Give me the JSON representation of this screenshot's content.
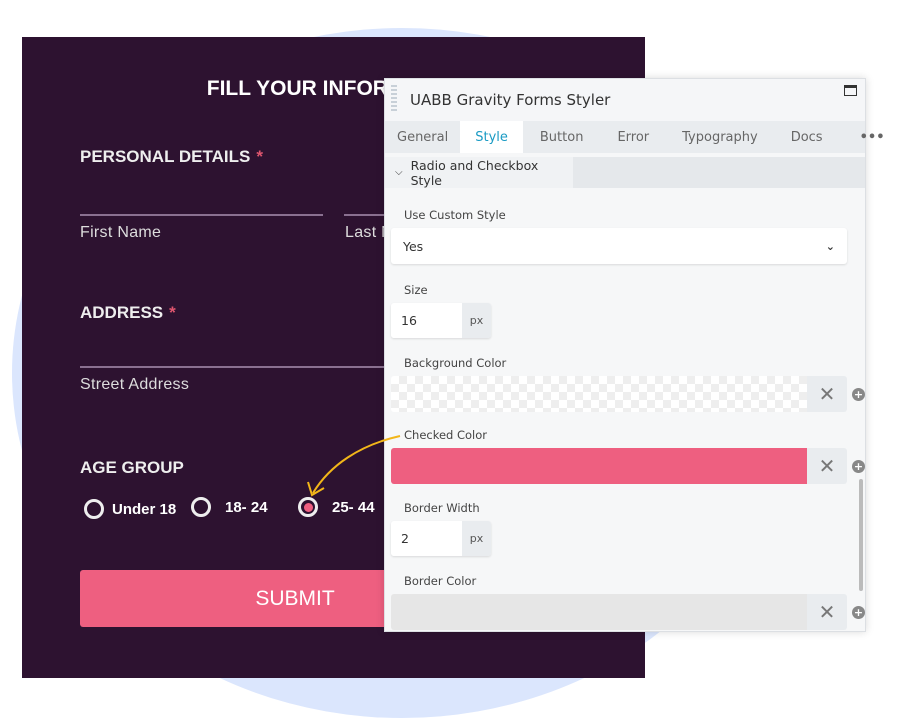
{
  "form": {
    "title": "FILL YOUR INFORMATION",
    "personal_details": "PERSONAL DETAILS",
    "required_mark": "*",
    "first_name": "First Name",
    "last_name": "Last Name",
    "address": "ADDRESS",
    "street_address": "Street Address",
    "age_group": "AGE GROUP",
    "age_options": [
      {
        "label": "Under 18",
        "checked": false
      },
      {
        "label": "18- 24",
        "checked": false
      },
      {
        "label": "25- 44",
        "checked": true
      }
    ],
    "submit": "SUBMIT"
  },
  "panel": {
    "title": "UABB Gravity Forms Styler",
    "tabs": [
      "General",
      "Style",
      "Button",
      "Error",
      "Typography",
      "Docs",
      "•••"
    ],
    "active_tab": "Style",
    "section": "Radio and Checkbox Style",
    "fields": {
      "use_custom_style": {
        "label": "Use Custom Style",
        "value": "Yes"
      },
      "size": {
        "label": "Size",
        "value": "16",
        "unit": "px"
      },
      "background_color": {
        "label": "Background Color",
        "value": "transparent"
      },
      "checked_color": {
        "label": "Checked Color",
        "value": "#ee5f80"
      },
      "border_width": {
        "label": "Border Width",
        "value": "2",
        "unit": "px"
      },
      "border_color": {
        "label": "Border Color",
        "value": "#e6e6e6"
      }
    }
  },
  "colors": {
    "form_bg": "#2d1230",
    "accent": "#ee5f80",
    "tab_active": "#1a9bc4",
    "arrow": "#f2b619"
  }
}
